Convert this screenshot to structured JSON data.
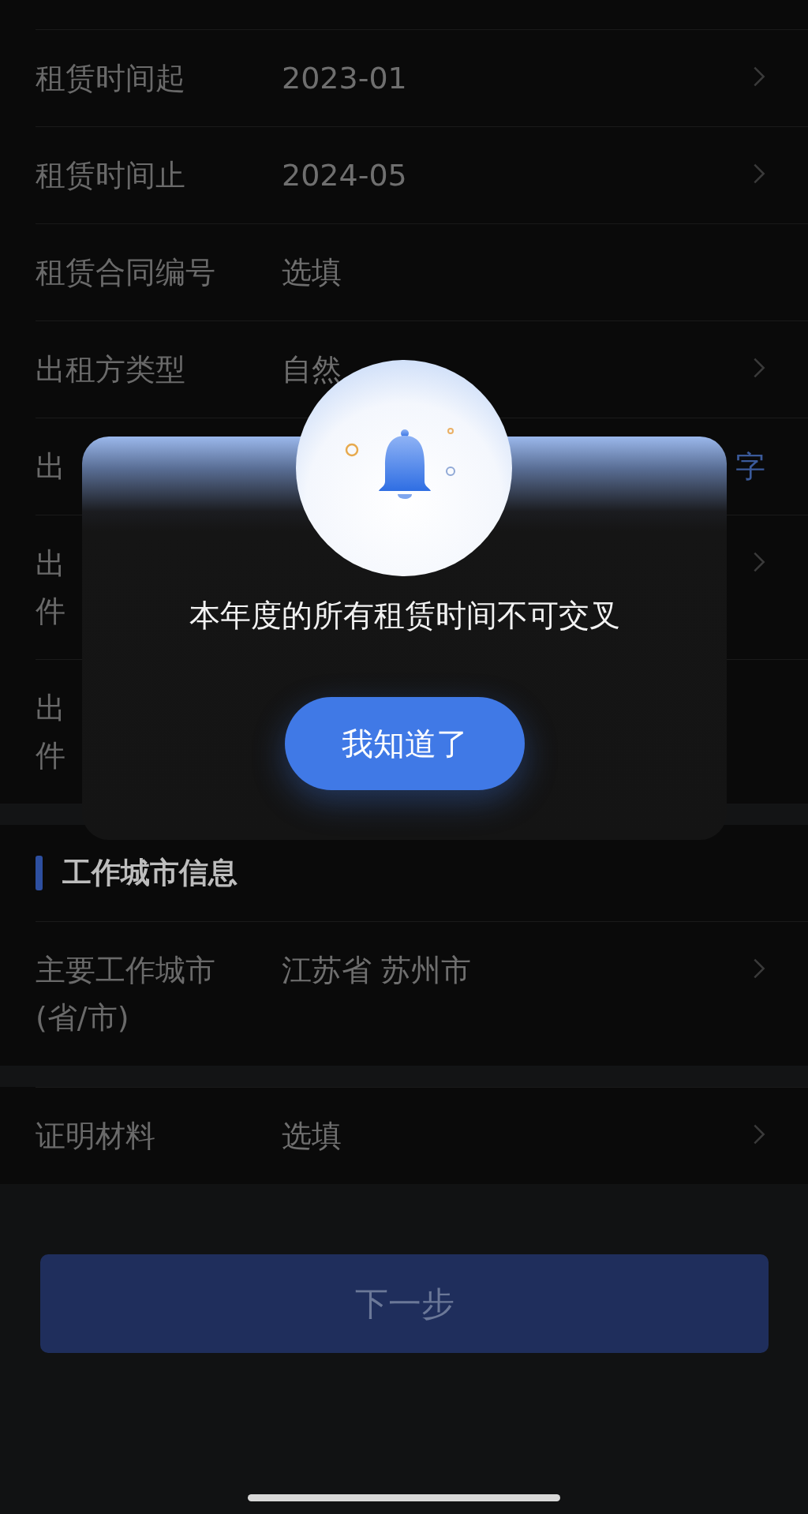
{
  "form_rows": [
    {
      "label": [
        "租赁时间起"
      ],
      "value": "2023-01",
      "kind": "text",
      "chevron": true
    },
    {
      "label": [
        "租赁时间止"
      ],
      "value": "2024-05",
      "kind": "text",
      "chevron": true
    },
    {
      "label": [
        "租赁合同编号"
      ],
      "value": "选填",
      "kind": "text",
      "chevron": false
    },
    {
      "label": [
        "出租方类型"
      ],
      "value": "自然",
      "kind": "text",
      "chevron": true
    },
    {
      "label": [
        "出"
      ],
      "value": "字",
      "kind": "link",
      "chevron": false
    },
    {
      "label": [
        "出",
        "件"
      ],
      "chevron": true
    },
    {
      "label": [
        "出",
        "件"
      ],
      "chevron": false
    }
  ],
  "work_city_section": {
    "title": "工作城市信息",
    "rows": [
      {
        "label": [
          "主要工作城市",
          "(省/市)"
        ],
        "value": "江苏省 苏州市",
        "kind": "text",
        "chevron": true
      }
    ]
  },
  "proof_rows": [
    {
      "label": [
        "证明材料"
      ],
      "value": "选填",
      "kind": "text",
      "chevron": true
    }
  ],
  "next_button": "下一步",
  "dialog": {
    "message": "本年度的所有租赁时间不可交叉",
    "button": "我知道了"
  }
}
